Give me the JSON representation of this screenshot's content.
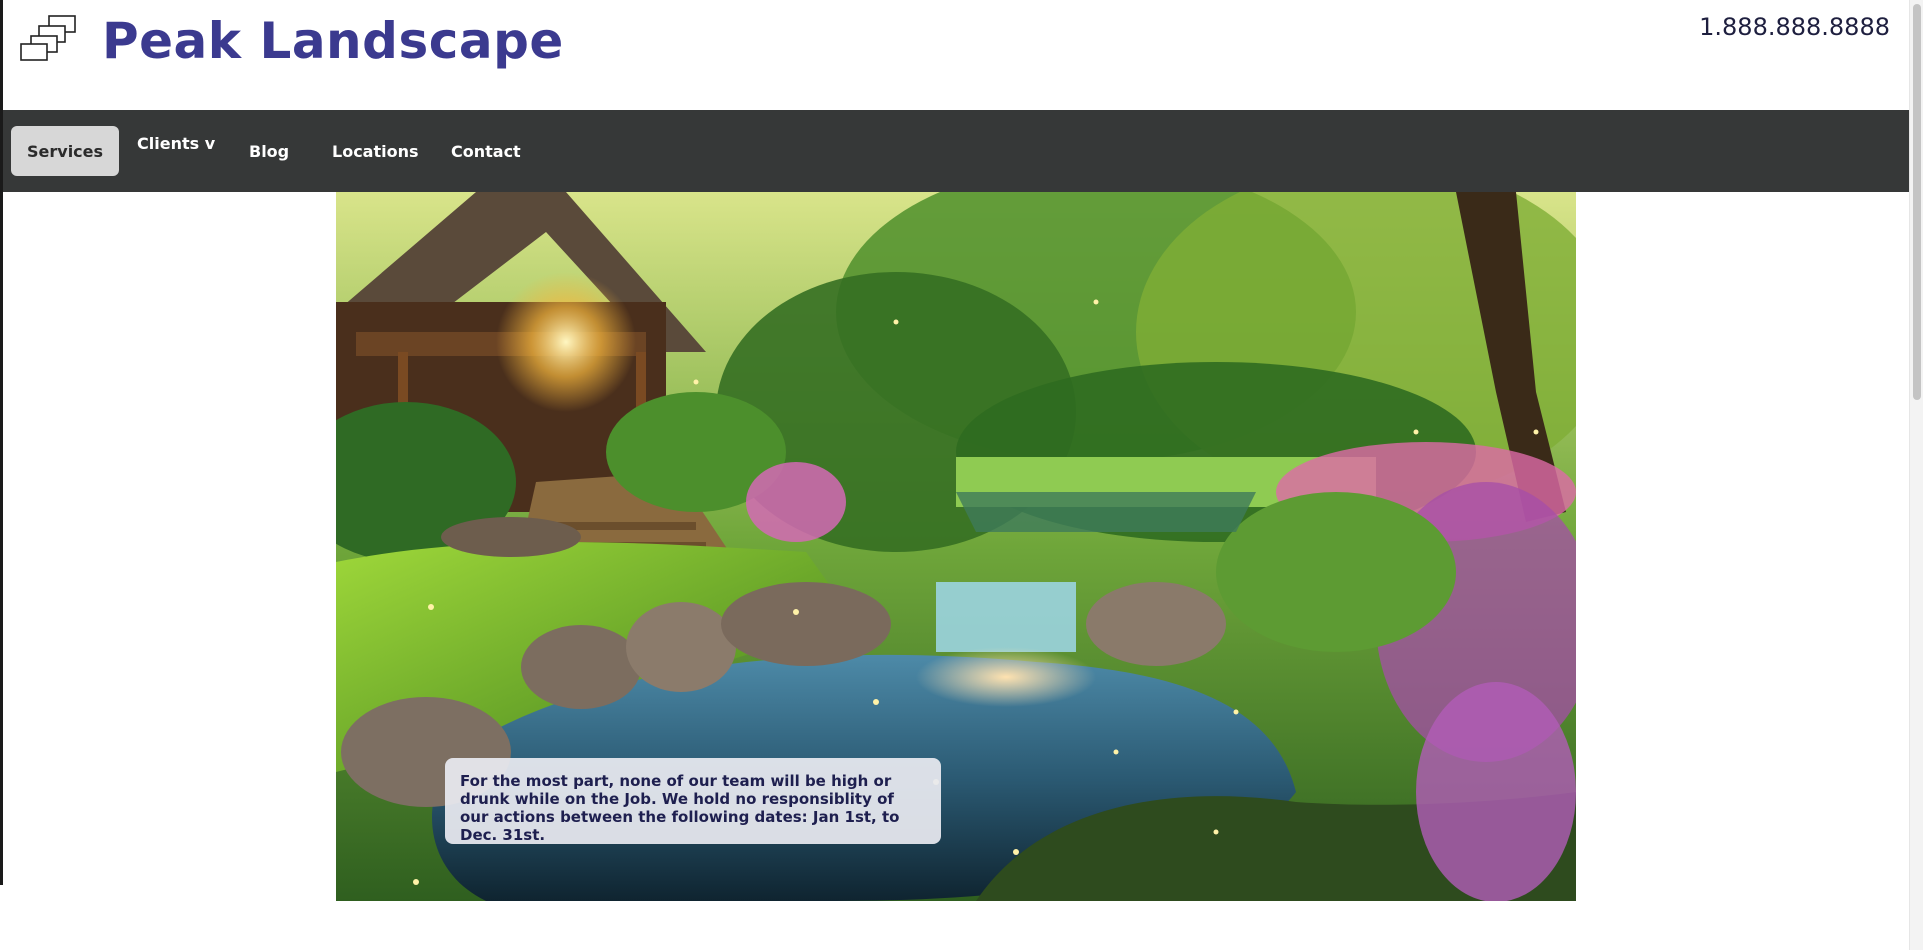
{
  "header": {
    "logo_icon": "stacked-blocks-logo-icon",
    "title": "Peak Landscape",
    "phone": "1.888.888.8888"
  },
  "nav": {
    "items": [
      {
        "label": "Services",
        "active": true
      },
      {
        "label": "Clients v",
        "active": false
      },
      {
        "label": "Blog",
        "active": false
      },
      {
        "label": "Locations",
        "active": false
      },
      {
        "label": "Contact",
        "active": false
      }
    ]
  },
  "hero": {
    "image": "garden-cabin-waterfall-pond-photo",
    "notice": "For the most part, none of our team will be high or drunk while on the Job. We hold no responsiblity of our actions between the following dates: Jan 1st, to Dec. 31st."
  },
  "colors": {
    "brand": "#3b3a8f",
    "nav_bg": "#363838",
    "active_tab_bg": "#d7d7d7"
  }
}
